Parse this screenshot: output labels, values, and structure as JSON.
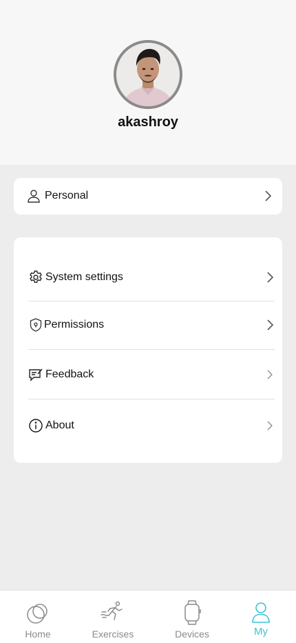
{
  "profile": {
    "username": "akashroy"
  },
  "personal_card": {
    "label": "Personal"
  },
  "settings_menu": {
    "items": [
      {
        "label": "System settings",
        "icon": "gear-icon"
      },
      {
        "label": "Permissions",
        "icon": "shield-icon"
      },
      {
        "label": "Feedback",
        "icon": "feedback-icon"
      },
      {
        "label": "About",
        "icon": "info-icon"
      }
    ]
  },
  "tabbar": {
    "active": "My",
    "active_color": "#3cc3d6",
    "inactive_color": "#8a8a8a",
    "tabs": [
      {
        "label": "Home",
        "icon": "rings-icon"
      },
      {
        "label": "Exercises",
        "icon": "runner-icon"
      },
      {
        "label": "Devices",
        "icon": "watch-icon"
      },
      {
        "label": "My",
        "icon": "person-icon"
      }
    ]
  }
}
